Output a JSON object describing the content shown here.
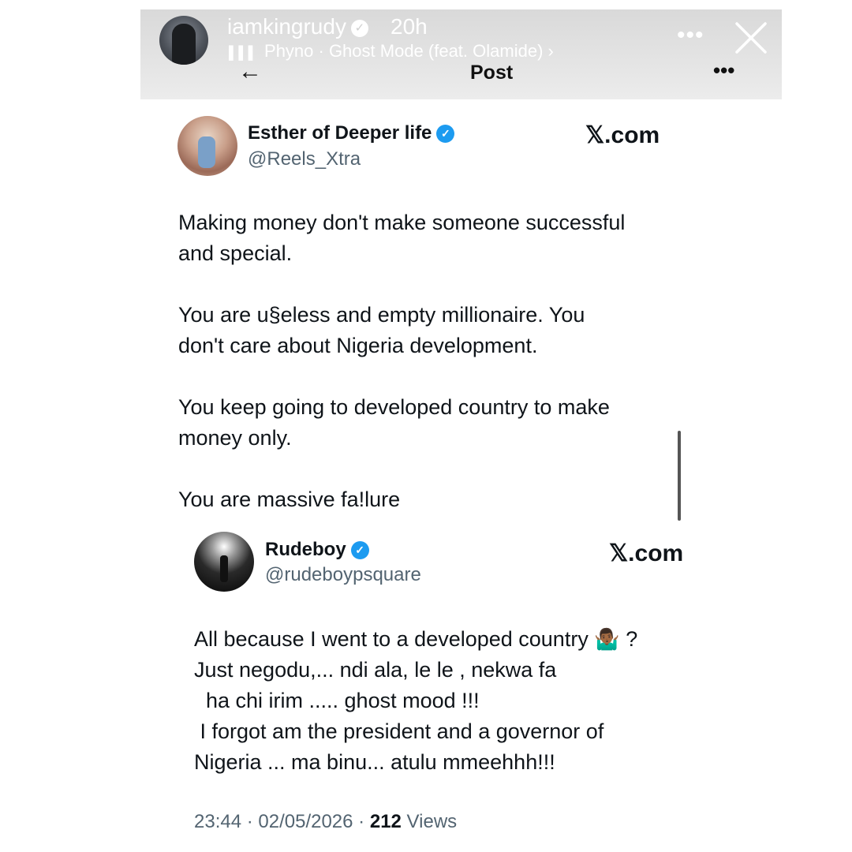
{
  "story": {
    "username": "iamkingrudy",
    "time": "20h",
    "music": "Phyno · Ghost Mode (feat. Olamide) ›"
  },
  "nav": {
    "title": "Post"
  },
  "tweet1": {
    "name": "Esther of Deeper life",
    "handle": "@Reels_Xtra",
    "brand": "𝕏.com",
    "lines": [
      "Making money don't make someone successful",
      "and special.",
      "",
      "You are u§eless and empty millionaire. You",
      "don't care about Nigeria development.",
      "",
      "You keep going to developed country to make",
      "money only.",
      "",
      "You are massive fa!lure"
    ]
  },
  "tweet2": {
    "name": "Rudeboy",
    "handle": "@rudeboypsquare",
    "brand": "𝕏.com",
    "line1": "All because I went to a developed country",
    "emoji": "🤷🏾‍♂️",
    "line1_end": "?",
    "lines": [
      "Just negodu,... ndi ala, le le , nekwa fa",
      "  ha chi irim ..... ghost mood !!!",
      " I forgot am the president and a governor of",
      "Nigeria ... ma binu... atulu mmeehhh!!!"
    ]
  },
  "meta": {
    "datetime": "23:44 · 02/05/2026 · ",
    "views_count": "212",
    "views_label": " Views"
  }
}
